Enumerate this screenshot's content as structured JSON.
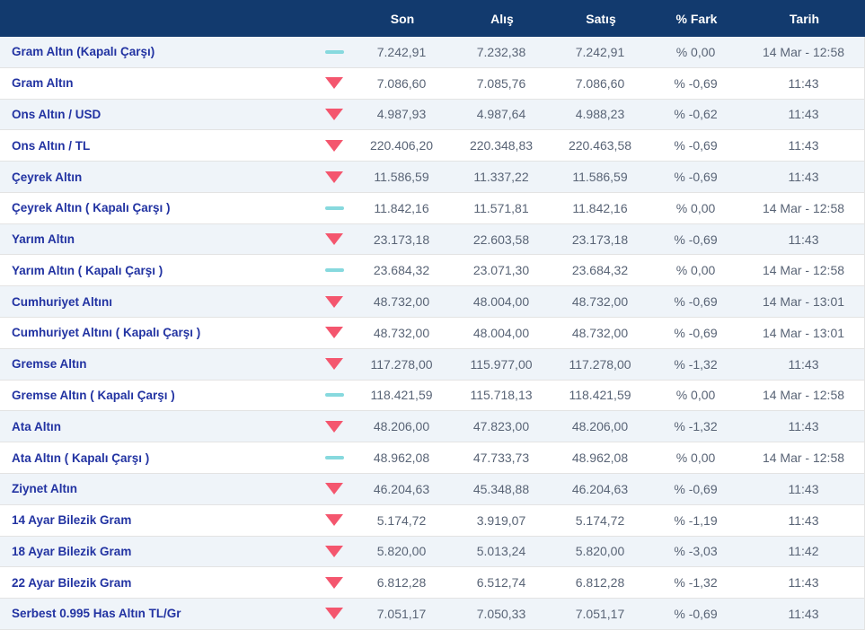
{
  "table": {
    "columns": [
      "Son",
      "Alış",
      "Satış",
      "% Fark",
      "Tarih"
    ],
    "rows": [
      {
        "name": "Gram Altın (Kapalı Çarşı)",
        "trend": "flat",
        "son": "7.242,91",
        "alis": "7.232,38",
        "satis": "7.242,91",
        "fark": "% 0,00",
        "tarih": "14 Mar - 12:58"
      },
      {
        "name": "Gram Altın",
        "trend": "down",
        "son": "7.086,60",
        "alis": "7.085,76",
        "satis": "7.086,60",
        "fark": "% -0,69",
        "tarih": "11:43"
      },
      {
        "name": "Ons Altın / USD",
        "trend": "down",
        "son": "4.987,93",
        "alis": "4.987,64",
        "satis": "4.988,23",
        "fark": "% -0,62",
        "tarih": "11:43"
      },
      {
        "name": "Ons Altın / TL",
        "trend": "down",
        "son": "220.406,20",
        "alis": "220.348,83",
        "satis": "220.463,58",
        "fark": "% -0,69",
        "tarih": "11:43"
      },
      {
        "name": "Çeyrek Altın",
        "trend": "down",
        "son": "11.586,59",
        "alis": "11.337,22",
        "satis": "11.586,59",
        "fark": "% -0,69",
        "tarih": "11:43"
      },
      {
        "name": "Çeyrek Altın ( Kapalı Çarşı )",
        "trend": "flat",
        "son": "11.842,16",
        "alis": "11.571,81",
        "satis": "11.842,16",
        "fark": "% 0,00",
        "tarih": "14 Mar - 12:58"
      },
      {
        "name": "Yarım Altın",
        "trend": "down",
        "son": "23.173,18",
        "alis": "22.603,58",
        "satis": "23.173,18",
        "fark": "% -0,69",
        "tarih": "11:43"
      },
      {
        "name": "Yarım Altın ( Kapalı Çarşı )",
        "trend": "flat",
        "son": "23.684,32",
        "alis": "23.071,30",
        "satis": "23.684,32",
        "fark": "% 0,00",
        "tarih": "14 Mar - 12:58"
      },
      {
        "name": "Cumhuriyet Altını",
        "trend": "down",
        "son": "48.732,00",
        "alis": "48.004,00",
        "satis": "48.732,00",
        "fark": "% -0,69",
        "tarih": "14 Mar - 13:01"
      },
      {
        "name": "Cumhuriyet Altını ( Kapalı Çarşı )",
        "trend": "down",
        "son": "48.732,00",
        "alis": "48.004,00",
        "satis": "48.732,00",
        "fark": "% -0,69",
        "tarih": "14 Mar - 13:01"
      },
      {
        "name": "Gremse Altın",
        "trend": "down",
        "son": "117.278,00",
        "alis": "115.977,00",
        "satis": "117.278,00",
        "fark": "% -1,32",
        "tarih": "11:43"
      },
      {
        "name": "Gremse Altın ( Kapalı Çarşı )",
        "trend": "flat",
        "son": "118.421,59",
        "alis": "115.718,13",
        "satis": "118.421,59",
        "fark": "% 0,00",
        "tarih": "14 Mar - 12:58"
      },
      {
        "name": "Ata Altın",
        "trend": "down",
        "son": "48.206,00",
        "alis": "47.823,00",
        "satis": "48.206,00",
        "fark": "% -1,32",
        "tarih": "11:43"
      },
      {
        "name": "Ata Altın ( Kapalı Çarşı )",
        "trend": "flat",
        "son": "48.962,08",
        "alis": "47.733,73",
        "satis": "48.962,08",
        "fark": "% 0,00",
        "tarih": "14 Mar - 12:58"
      },
      {
        "name": "Ziynet Altın",
        "trend": "down",
        "son": "46.204,63",
        "alis": "45.348,88",
        "satis": "46.204,63",
        "fark": "% -0,69",
        "tarih": "11:43"
      },
      {
        "name": "14 Ayar Bilezik Gram",
        "trend": "down",
        "son": "5.174,72",
        "alis": "3.919,07",
        "satis": "5.174,72",
        "fark": "% -1,19",
        "tarih": "11:43"
      },
      {
        "name": "18 Ayar Bilezik Gram",
        "trend": "down",
        "son": "5.820,00",
        "alis": "5.013,24",
        "satis": "5.820,00",
        "fark": "% -3,03",
        "tarih": "11:42"
      },
      {
        "name": "22 Ayar Bilezik Gram",
        "trend": "down",
        "son": "6.812,28",
        "alis": "6.512,74",
        "satis": "6.812,28",
        "fark": "% -1,32",
        "tarih": "11:43"
      },
      {
        "name": "Serbest 0.995 Has Altın TL/Gr",
        "trend": "down",
        "son": "7.051,17",
        "alis": "7.050,33",
        "satis": "7.051,17",
        "fark": "% -0,69",
        "tarih": "11:43"
      }
    ]
  },
  "colors": {
    "header_bg": "#123a6e",
    "row_alt_bg": "#eff4f9",
    "divider": "#e3e3e3",
    "name_color": "#2233a2",
    "value_color": "#596476",
    "down_triangle": "#f4566e",
    "flat_dash": "#87d9de"
  },
  "icons": {
    "down": "down-triangle-icon",
    "flat": "flat-dash-icon"
  }
}
